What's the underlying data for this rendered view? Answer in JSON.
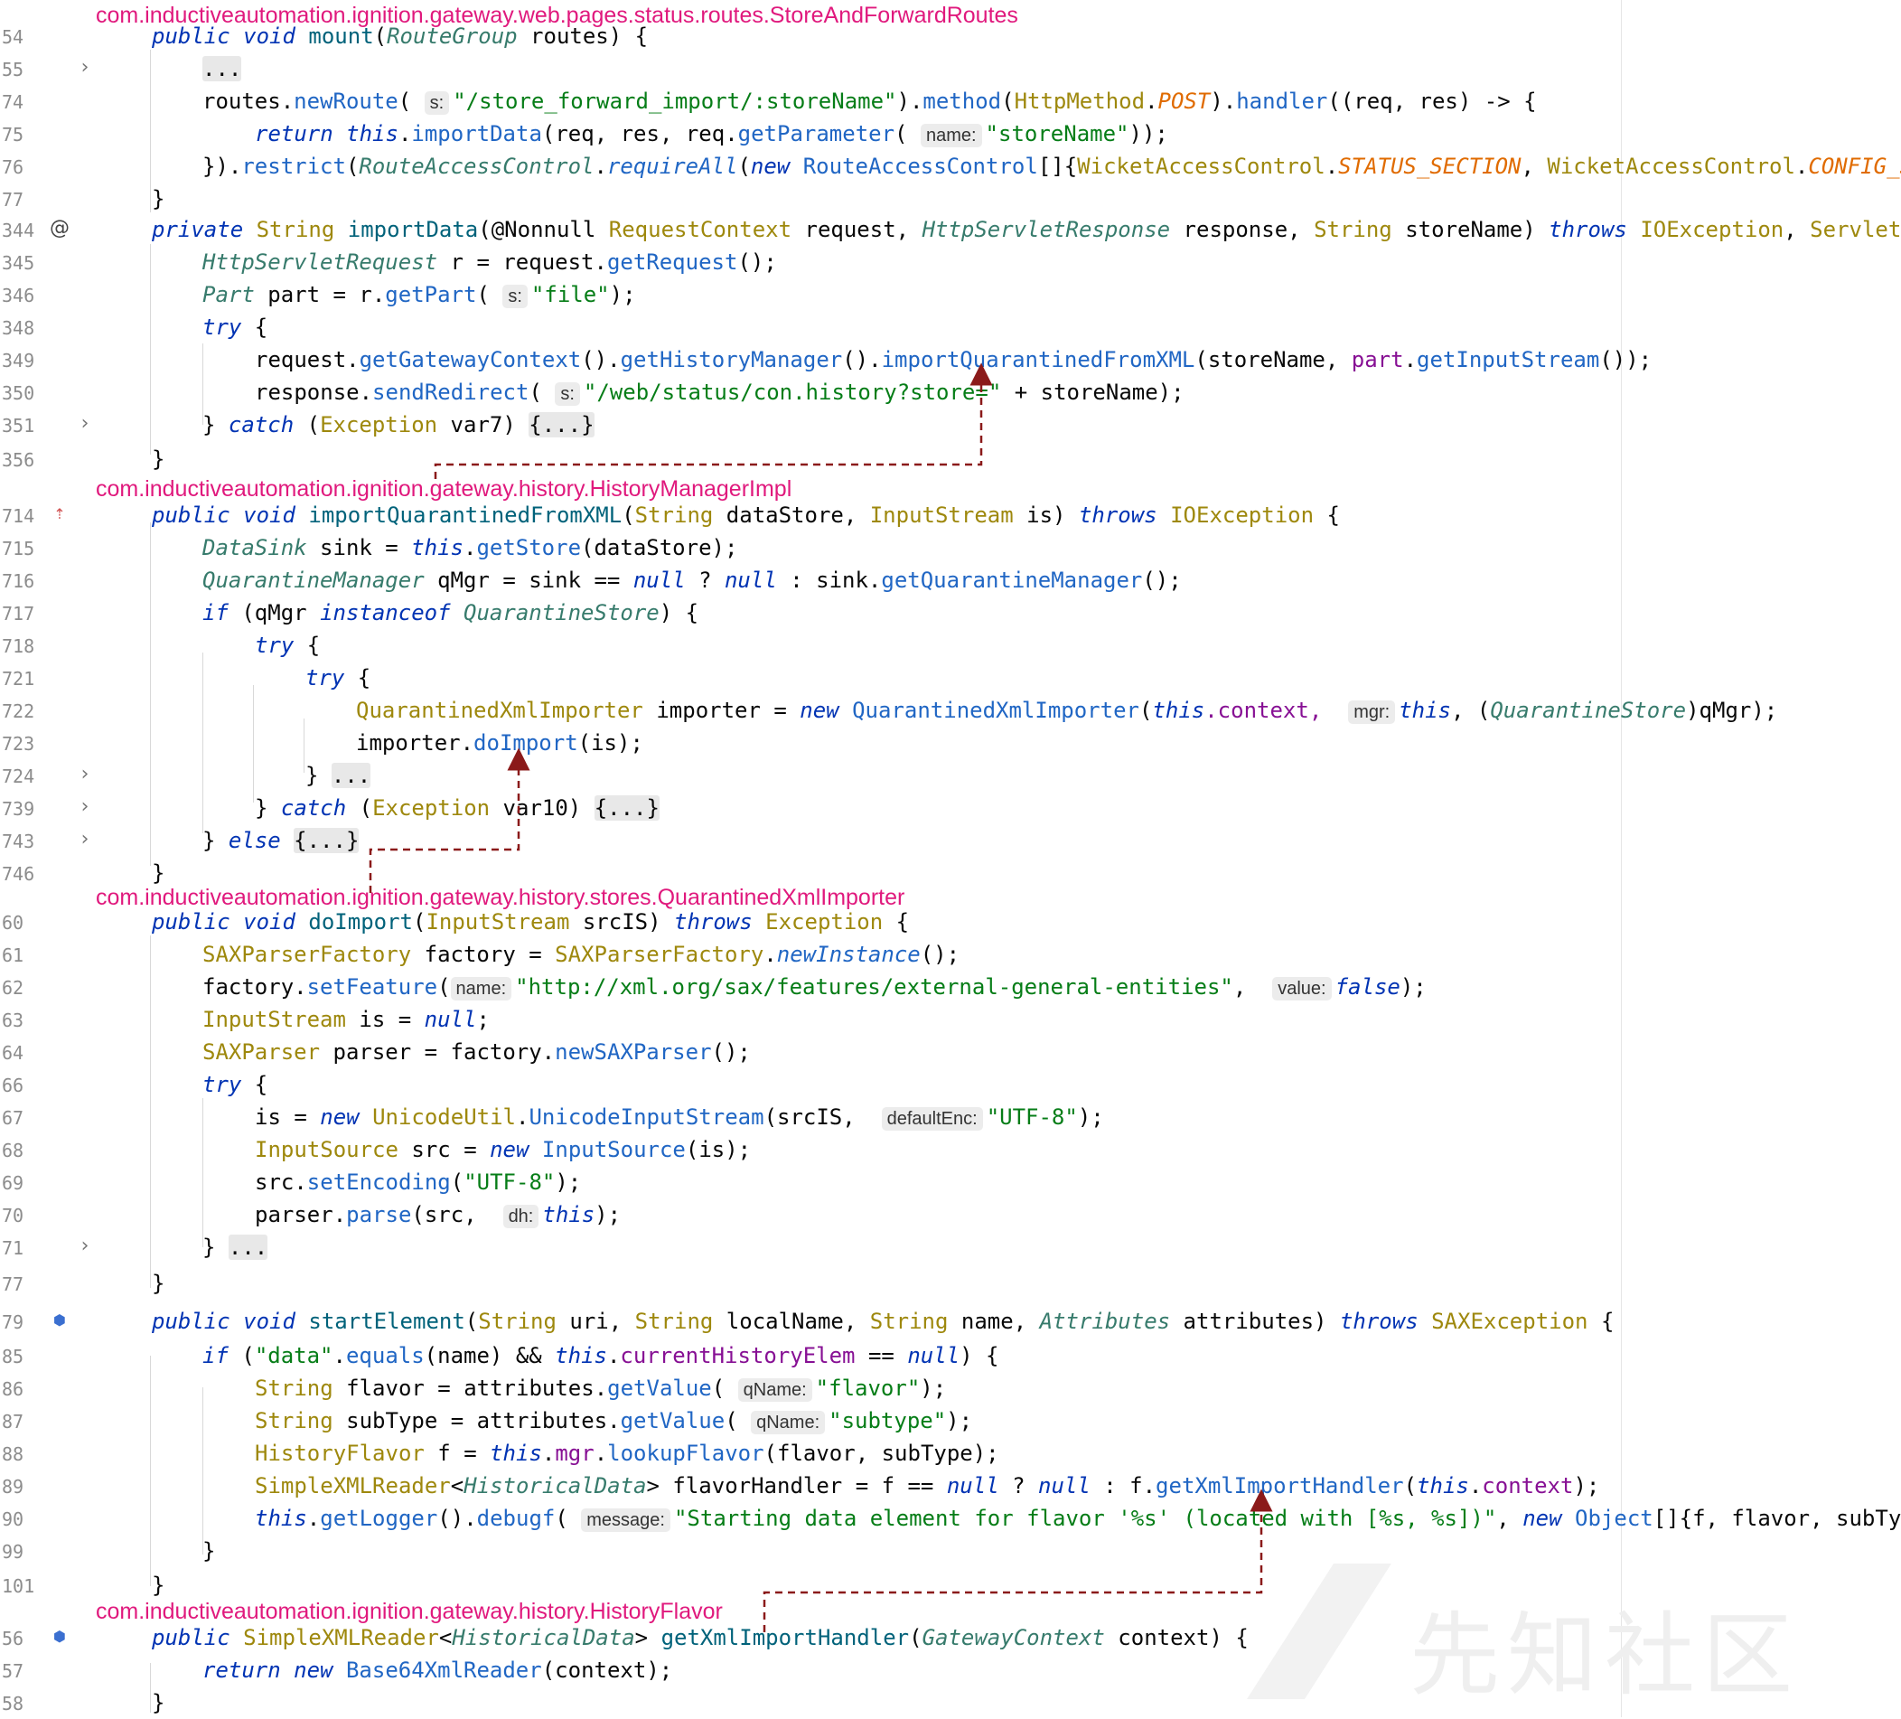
{
  "watermark": "先知社区",
  "sections": [
    {
      "pkg": "com.inductiveautomation.ignition.gateway.web.pages.status.routes.StoreAndForwardRoutes"
    },
    {
      "pkg": "com.inductiveautomation.ignition.gateway.history.HistoryManagerImpl"
    },
    {
      "pkg": "com.inductiveautomation.ignition.gateway.history.stores.QuarantinedXmlImporter"
    },
    {
      "pkg": "com.inductiveautomation.ignition.gateway.history.HistoryFlavor"
    }
  ],
  "lines": [
    {
      "n": "54"
    },
    {
      "n": "55"
    },
    {
      "n": "74"
    },
    {
      "n": "75"
    },
    {
      "n": "76"
    },
    {
      "n": "77"
    },
    {
      "n": "344"
    },
    {
      "n": "345"
    },
    {
      "n": "346"
    },
    {
      "n": "348"
    },
    {
      "n": "349"
    },
    {
      "n": "350"
    },
    {
      "n": "351"
    },
    {
      "n": "356"
    },
    {
      "n": "714"
    },
    {
      "n": "715"
    },
    {
      "n": "716"
    },
    {
      "n": "717"
    },
    {
      "n": "718"
    },
    {
      "n": "721"
    },
    {
      "n": "722"
    },
    {
      "n": "723"
    },
    {
      "n": "724"
    },
    {
      "n": "739"
    },
    {
      "n": "743"
    },
    {
      "n": "746"
    },
    {
      "n": "60"
    },
    {
      "n": "61"
    },
    {
      "n": "62"
    },
    {
      "n": "63"
    },
    {
      "n": "64"
    },
    {
      "n": "66"
    },
    {
      "n": "67"
    },
    {
      "n": "68"
    },
    {
      "n": "69"
    },
    {
      "n": "70"
    },
    {
      "n": "71"
    },
    {
      "n": "77"
    },
    {
      "n": "79"
    },
    {
      "n": "85"
    },
    {
      "n": "86"
    },
    {
      "n": "87"
    },
    {
      "n": "88"
    },
    {
      "n": "89"
    },
    {
      "n": "90"
    },
    {
      "n": "99"
    },
    {
      "n": "101"
    },
    {
      "n": "56"
    },
    {
      "n": "57"
    },
    {
      "n": "58"
    }
  ],
  "t": {
    "public": "public",
    "void": "void",
    "mount": "mount",
    "RouteGroup": "RouteGroup",
    "routes": " routes) {",
    "ellipsis": "...",
    "routesDot": "routes.",
    "newRoute": "newRoute",
    "lp": "(",
    "hS": "s:",
    "s_route": "\"/store_forward_import/:storeName\"",
    "rpDot": ").",
    "method": "method",
    "HttpMethod": "HttpMethod",
    "POST": "POST",
    "handler": "handler",
    "lambda": "((req, res) -> {",
    "return": "return",
    "this": "this",
    "importData": "importData",
    "reqres": "(req, res, req.",
    "getParameter": "getParameter",
    "hName": "name:",
    "s_storeName": "\"storeName\"",
    "endCall": "));",
    "closeLambda": "}).",
    "restrict": "restrict",
    "RAC": "RouteAccessControl",
    "requireAll": "requireAll",
    "new": "new",
    "RACarr": "RouteAccessControl",
    "brk": "[]{",
    "WAC": "WicketAccessControl",
    "STATUS": "STATUS_SECTION",
    "comma": ", ",
    "CONFIG": "CONFIG_SECT",
    "closeBrace": "}",
    "private": "private",
    "String": "String",
    "annot": "(@Nonnull ",
    "RequestContext": "RequestContext",
    "request": " request, ",
    "HSResp": "HttpServletResponse",
    "response": " response, ",
    "storeName": " storeName) ",
    "throws": "throws",
    "IOException": "IOException",
    "ServletExce": "ServletExce",
    "HSReq": "HttpServletRequest",
    "rEq": " r = request.",
    "getRequest": "getRequest",
    "paren": "();",
    "Part": "Part",
    "partEq": " part = r.",
    "getPart": "getPart",
    "s_file": "\"file\"",
    "rpSemi": ");",
    "try": "try",
    "braceOpen": " {",
    "requestDot": "request.",
    "getGatewayContext": "getGatewayContext",
    "pd": "().",
    "getHistoryManager": "getHistoryManager",
    "importQFX": "importQuarantinedFromXML",
    "storeNameC": "(storeName, ",
    "part": "part",
    "dot": ".",
    "getInputStream": "getInputStream",
    "endCall2": "());",
    "responseDot": "response.",
    "sendRedirect": "sendRedirect",
    "s_redirect": "\"/web/status/con.history?store=\"",
    "plusStore": " + storeName);",
    "catch": "catch",
    "excVar7": "Exception",
    "var7": " var7) ",
    "foldBraces": "{...}",
    "importQFXsig": "importQuarantinedFromXML",
    "dataStore": " dataStore, ",
    "InputStream": "InputStream",
    "is": " is) ",
    "DataSink": "DataSink",
    "sinkEq": " sink = ",
    "getStore": "getStore",
    "dsSemi": "(dataStore);",
    "QM": "QuarantineManager",
    "qMgrEq": " qMgr = sink == ",
    "null": "null",
    "q": " ? ",
    "colon": " : sink.",
    "getQM": "getQuarantineManager",
    "if": "if",
    "qMgrP": " (qMgr ",
    "instanceof": "instanceof",
    "QStore": "QuarantineStore",
    "rpBrace": ") {",
    "QXI": "QuarantinedXmlImporter",
    "importerEq": " importer = ",
    "contextC": ".context, ",
    "hMgr": "mgr:",
    "castOpen": ", (",
    "qMgrEnd": ")qMgr);",
    "importerDot": "importer.",
    "doImport": "doImport",
    "isSemi": "(is);",
    "closeSpace": "} ",
    "excVar10": "Exception",
    "var10": " var10) ",
    "else": "else",
    "catchOpen": " (",
    "srcIS": " srcIS) ",
    "Exception": "Exception",
    "SAXPF": "SAXParserFactory",
    "factoryEq": " factory = ",
    "newInstance": "newInstance",
    "factoryDot": "factory.",
    "setFeature": "setFeature",
    "s_ext": "\"http://xml.org/sax/features/external-general-entities\"",
    "hValue": "value:",
    "false": "false",
    "isEq": " is = ",
    "semi": ";",
    "SAXParser": "SAXParser",
    "parserEq": " parser = factory.",
    "newSAXParser": "newSAXParser",
    "isAssign": "is = ",
    "UnicodeUtil": "UnicodeUtil",
    "UIS": "UnicodeInputStream",
    "srcISc": "(srcIS, ",
    "hDefEnc": "defaultEnc:",
    "s_utf8": "\"UTF-8\"",
    "InputSource": "InputSource",
    "srcEq": " src = ",
    "isParen": "(is);",
    "srcDot": "src.",
    "setEncoding": "setEncoding",
    "parserDot": "parser.",
    "parse": "parse",
    "srcC": "(src, ",
    "hDh": "dh:",
    "startElement": "startElement",
    "uri": " uri, ",
    "localName": " localName, ",
    "nameC": " name, ",
    "Attributes": "Attributes",
    "attributes": " attributes) ",
    "SAXException": "SAXException",
    "s_data": "\"data\"",
    "equals": "equals",
    "nameAnd": "(name) && ",
    "currentHistoryElem": "currentHistoryElem",
    "eqNull": " == ",
    "flavorEq": " flavor = attributes.",
    "getValue": "getValue",
    "hQName": "qName:",
    "s_flavor": "\"flavor\"",
    "subTypeEq": " subType = attributes.",
    "s_subtype": "\"subtype\"",
    "HF": "HistoryFlavor",
    "fEq": " f = ",
    "mgr": "mgr",
    "lookupFlavor": "lookupFlavor",
    "flavorSub": "(flavor, subType);",
    "SXR": "SimpleXMLReader",
    "HD": "HistoricalData",
    "fhEq": "> flavorHandler = f == ",
    "colonF": " : f.",
    "getXIH": "getXmlImportHandler",
    "context": "context",
    "getLogger": "getLogger",
    "debugf": "debugf",
    "hMessage": "message:",
    "s_debug": "\"Starting data element for flavor '%s' (located with [%s, %s])\"",
    "Object": "Object",
    "objArgs": "{f, flavor, subType});",
    "lt": "<",
    "gt": "> ",
    "GC": "GatewayContext",
    "contextSig": " context) {",
    "B64": "Base64XmlReader",
    "ctxSemi": "(context);"
  }
}
